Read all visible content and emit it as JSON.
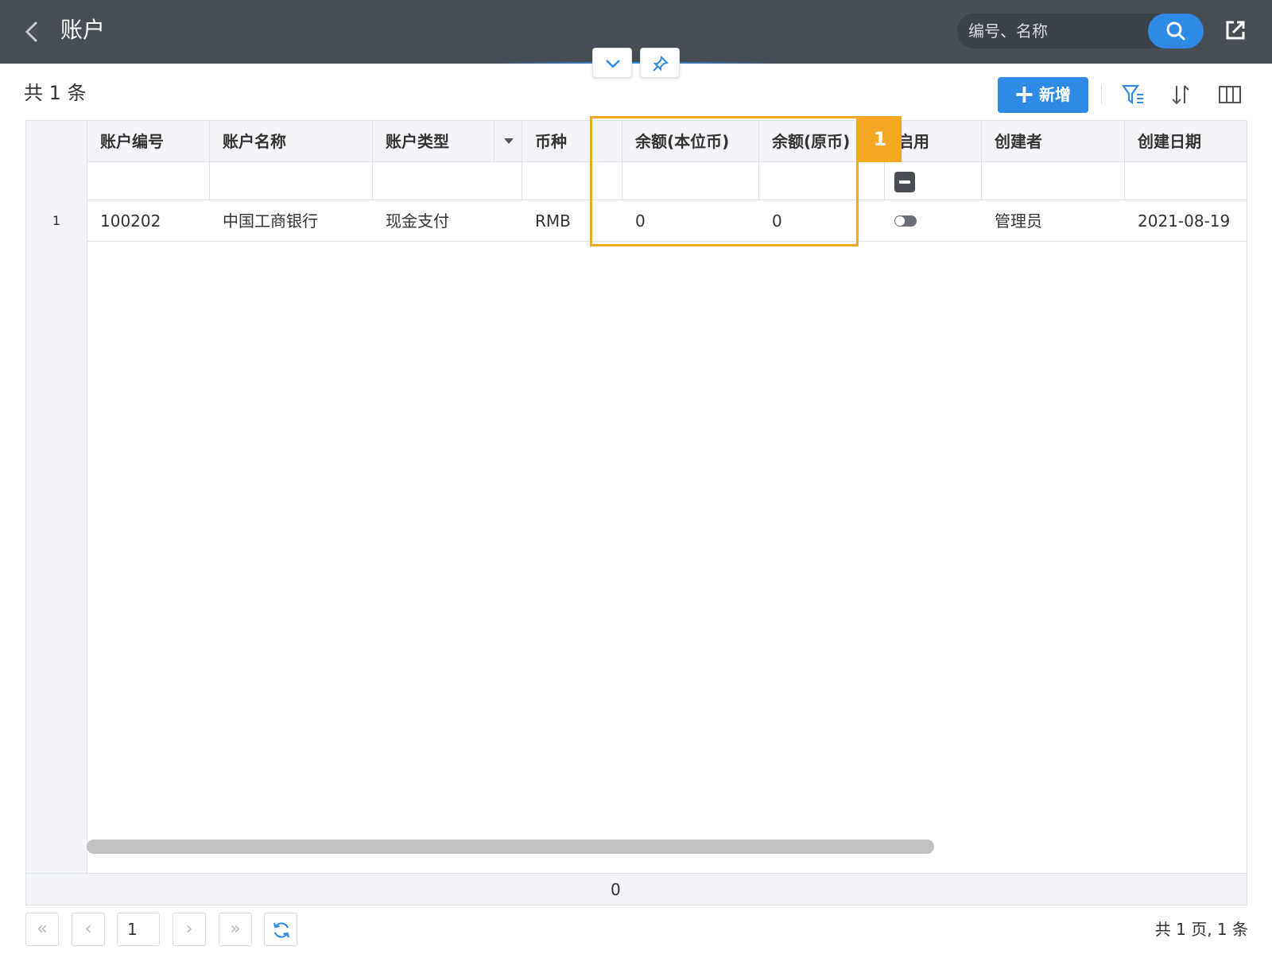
{
  "header": {
    "title": "账户",
    "search_placeholder": "编号、名称",
    "back_icon": "chevron-left-icon",
    "search_icon": "search-icon",
    "share_icon": "external-share-icon"
  },
  "toolbar": {
    "total_label": "共 1 条",
    "add_button_label": "新增",
    "add_icon": "plus-icon",
    "filter_icon": "filter-icon",
    "sort_icon": "sort-icon",
    "columns_icon": "columns-icon"
  },
  "grid": {
    "columns": [
      {
        "key": "code",
        "label": "账户编号"
      },
      {
        "key": "name",
        "label": "账户名称"
      },
      {
        "key": "type",
        "label": "账户类型"
      },
      {
        "key": "currency",
        "label": "币种"
      },
      {
        "key": "balance_local",
        "label": "余额(本位币)"
      },
      {
        "key": "balance_original",
        "label": "余额(原币)"
      },
      {
        "key": "enabled",
        "label": "启用"
      },
      {
        "key": "creator",
        "label": "创建者"
      },
      {
        "key": "created_date",
        "label": "创建日期"
      }
    ],
    "rows": [
      {
        "row_number": "1",
        "code": "100202",
        "name": "中国工商银行",
        "type": "现金支付",
        "currency": "RMB",
        "balance_local": "0",
        "balance_original": "0",
        "enabled": false,
        "creator": "管理员",
        "created_date": "2021-08-19"
      }
    ],
    "summary_value": "0"
  },
  "annotation": {
    "badge_label": "1",
    "color": "#f5a623"
  },
  "pagination": {
    "first_label": "«",
    "prev_label": "‹",
    "next_label": "›",
    "last_label": "»",
    "current_page": "1",
    "summary": "共 1 页, 1 条",
    "refresh_icon": "refresh-icon"
  },
  "colors": {
    "header_bg": "#474e56",
    "accent": "#2f8ae6",
    "highlight": "#f5a623"
  }
}
